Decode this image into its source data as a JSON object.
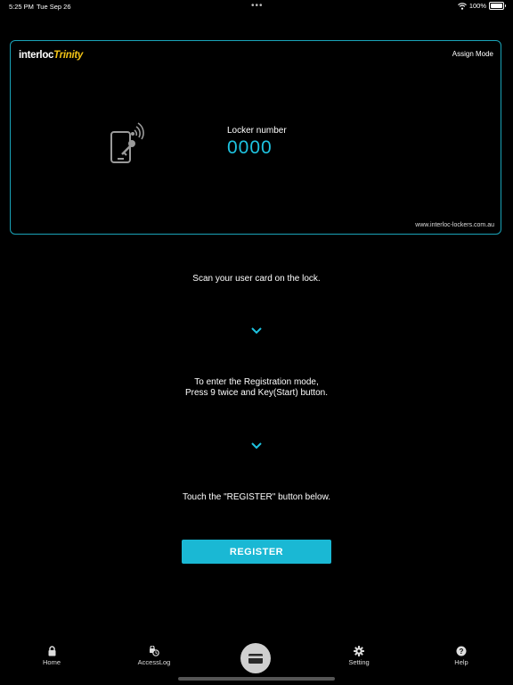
{
  "status": {
    "time": "5:25 PM",
    "date": "Tue Sep 26",
    "battery": "100%",
    "battery_level": 1.0
  },
  "card": {
    "logo_a": "interloc",
    "logo_b": "Trinity",
    "mode": "Assign Mode",
    "locker_label": "Locker number",
    "locker_number": "0000",
    "website": "www.interloc-lockers.com.au",
    "accent_color": "#1aa3b8"
  },
  "instructions": {
    "step1": "Scan your user card on the lock.",
    "step2_line1": "To enter the Registration mode,",
    "step2_line2": "Press 9 twice and Key(Start) button.",
    "step3": "Touch the \"REGISTER\" button below."
  },
  "register_button": {
    "label": "REGISTER",
    "color": "#1ab8d4"
  },
  "tabs": [
    {
      "label": "Home",
      "icon": "lock-icon"
    },
    {
      "label": "AccessLog",
      "icon": "access-log-icon"
    },
    {
      "label": "",
      "icon": "card-icon"
    },
    {
      "label": "Setting",
      "icon": "gear-icon"
    },
    {
      "label": "Help",
      "icon": "help-icon"
    }
  ]
}
